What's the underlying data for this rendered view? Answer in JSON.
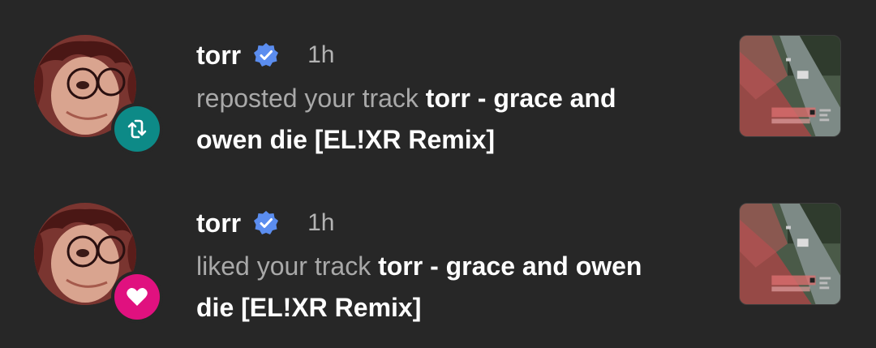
{
  "notifications": [
    {
      "username": "torr",
      "verified": true,
      "time": "1h",
      "action_text": "reposted your track",
      "track_title": "torr - grace and owen die [EL!XR Remix]",
      "badge_icon": "repost-icon",
      "badge_color": "#0d8a87"
    },
    {
      "username": "torr",
      "verified": true,
      "time": "1h",
      "action_text": "liked your track",
      "track_title": "torr - grace and owen die [EL!XR Remix]",
      "badge_icon": "heart-icon",
      "badge_color": "#e0117f"
    }
  ],
  "colors": {
    "background": "#272727",
    "verified_blue": "#5b8def",
    "muted_text": "#a9a9a9"
  }
}
